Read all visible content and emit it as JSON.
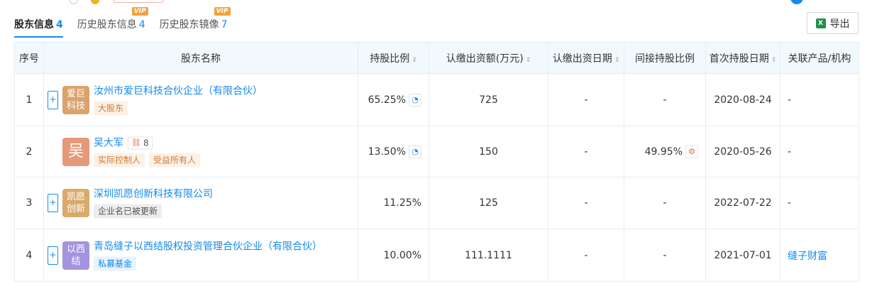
{
  "tabs": [
    {
      "label": "股东信息",
      "count": "4",
      "active": true,
      "vip": ""
    },
    {
      "label": "历史股东信息",
      "count": "4",
      "active": false,
      "vip": "VIP"
    },
    {
      "label": "历史股东镜像",
      "count": "7",
      "active": false,
      "vip": "VIP"
    }
  ],
  "export": {
    "label": "导出",
    "icon": "excel-icon"
  },
  "columns": {
    "index": "序号",
    "name": "股东名称",
    "ratio": "持股比例",
    "amount": "认缴出资额(万元)",
    "date": "认缴出资日期",
    "indirect": "间接持股比例",
    "first": "首次持股日期",
    "related": "关联产品/机构"
  },
  "sort_icon": "⇕",
  "rows": [
    {
      "index": "1",
      "expander": "+",
      "avatar": "爱巨科技",
      "name": "汝州市爱巨科技合伙企业（有限合伙）",
      "relation_count": "",
      "tags": [
        "大股东"
      ],
      "ratio": "65.25%",
      "amount": "725",
      "date": "-",
      "indirect": "-",
      "first": "2020-08-24",
      "related": "-"
    },
    {
      "index": "2",
      "expander": "",
      "avatar": "吴",
      "name": "吴大军",
      "relation_count": "8",
      "tags": [
        "实际控制人",
        "受益所有人"
      ],
      "ratio": "13.50%",
      "amount": "150",
      "date": "-",
      "indirect": "49.95%",
      "first": "2020-05-26",
      "related": "-"
    },
    {
      "index": "3",
      "expander": "+",
      "avatar": "凯愿创新",
      "name": "深圳凯愿创新科技有限公司",
      "relation_count": "",
      "tags": [
        "企业名已被更新"
      ],
      "ratio": "11.25%",
      "amount": "125",
      "date": "-",
      "indirect": "-",
      "first": "2022-07-22",
      "related": "-"
    },
    {
      "index": "4",
      "expander": "+",
      "avatar": "以西结",
      "name": "青岛缝子以西结股权投资管理合伙企业（有限合伙）",
      "relation_count": "",
      "tags": [
        "私募基金"
      ],
      "ratio": "10.00%",
      "amount": "111.1111",
      "date": "-",
      "indirect": "-",
      "first": "2021-07-01",
      "related": "缝子财富"
    }
  ]
}
